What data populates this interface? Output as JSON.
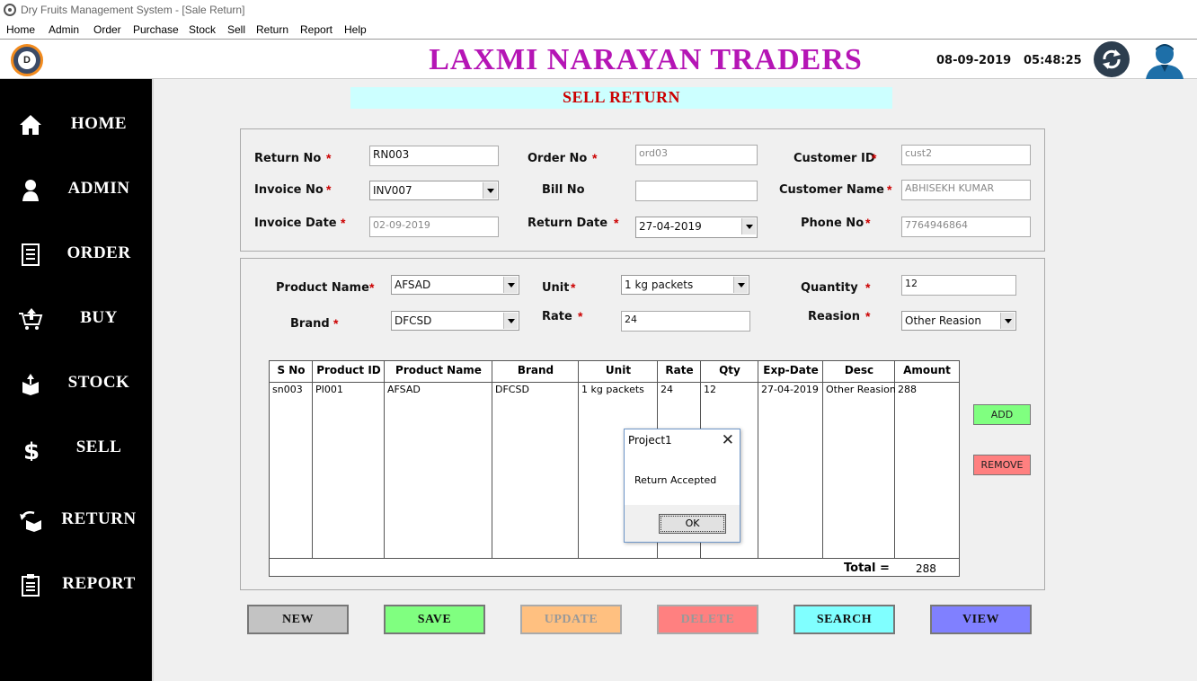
{
  "window": {
    "title": "Dry Fruits Management System - [Sale Return]"
  },
  "menu": [
    "Home",
    "Admin",
    "Order",
    "Purchase",
    "Stock",
    "Sell",
    "Return",
    "Report",
    "Help"
  ],
  "header": {
    "company": "LAXMI NARAYAN TRADERS",
    "date": "08-09-2019",
    "time": "05:48:25",
    "logo_letter": "D"
  },
  "sidebar": [
    {
      "label": "HOME",
      "icon": "home-icon"
    },
    {
      "label": "ADMIN",
      "icon": "person-icon"
    },
    {
      "label": "ORDER",
      "icon": "document-icon"
    },
    {
      "label": "BUY",
      "icon": "cart-icon"
    },
    {
      "label": "STOCK",
      "icon": "box-icon"
    },
    {
      "label": "SELL",
      "icon": "dollar-icon"
    },
    {
      "label": "RETURN",
      "icon": "return-icon"
    },
    {
      "label": "REPORT",
      "icon": "clipboard-icon"
    }
  ],
  "page_title": "SELL RETURN",
  "form": {
    "return_no": {
      "label": "Return No",
      "value": "RN003"
    },
    "order_no": {
      "label": "Order No",
      "value": "ord03"
    },
    "customer_id": {
      "label": "Customer ID",
      "value": "cust2"
    },
    "invoice_no": {
      "label": "Invoice No",
      "value": "INV007"
    },
    "bill_no": {
      "label": "Bill No",
      "value": ""
    },
    "customer_name": {
      "label": "Customer Name",
      "value": "ABHISEKH KUMAR"
    },
    "invoice_date": {
      "label": "Invoice Date",
      "value": "02-09-2019"
    },
    "return_date": {
      "label": "Return Date",
      "value": "27-04-2019"
    },
    "phone_no": {
      "label": "Phone No",
      "value": "7764946864"
    }
  },
  "product": {
    "product_name": {
      "label": "Product Name",
      "value": "AFSAD"
    },
    "unit": {
      "label": "Unit",
      "value": "1 kg packets"
    },
    "quantity": {
      "label": "Quantity",
      "value": "12"
    },
    "brand": {
      "label": "Brand",
      "value": "DFCSD"
    },
    "rate": {
      "label": "Rate",
      "value": "24"
    },
    "reason": {
      "label": "Reasion",
      "value": "Other Reasion"
    }
  },
  "grid": {
    "headers": [
      "S No",
      "Product ID",
      "Product Name",
      "Brand",
      "Unit",
      "Rate",
      "Qty",
      "Exp-Date",
      "Desc",
      "Amount"
    ],
    "rows": [
      [
        "sn003",
        "PI001",
        "AFSAD",
        "DFCSD",
        "1 kg packets",
        "24",
        "12",
        "27-04-2019",
        "Other Reasion",
        "288"
      ]
    ],
    "total_label": "Total  =",
    "total_value": "288"
  },
  "side_buttons": {
    "add": "ADD",
    "remove": "REMOVE"
  },
  "actions": {
    "new": "NEW",
    "save": "SAVE",
    "update": "UPDATE",
    "delete": "DELETE",
    "search": "SEARCH",
    "view": "VIEW"
  },
  "dialog": {
    "title": "Project1",
    "message": "Return Accepted",
    "ok": "OK"
  },
  "colors": {
    "sidebar": "#000000",
    "company": "#b515b5",
    "title_bg": "#ccffff",
    "title_text": "#cc0000",
    "new": "#c3c3c3",
    "save": "#80ff80",
    "update": "#ffc080",
    "delete": "#ff8080",
    "search": "#80ffff",
    "view": "#8080ff",
    "add": "#80ff80",
    "remove": "#ff8080"
  }
}
